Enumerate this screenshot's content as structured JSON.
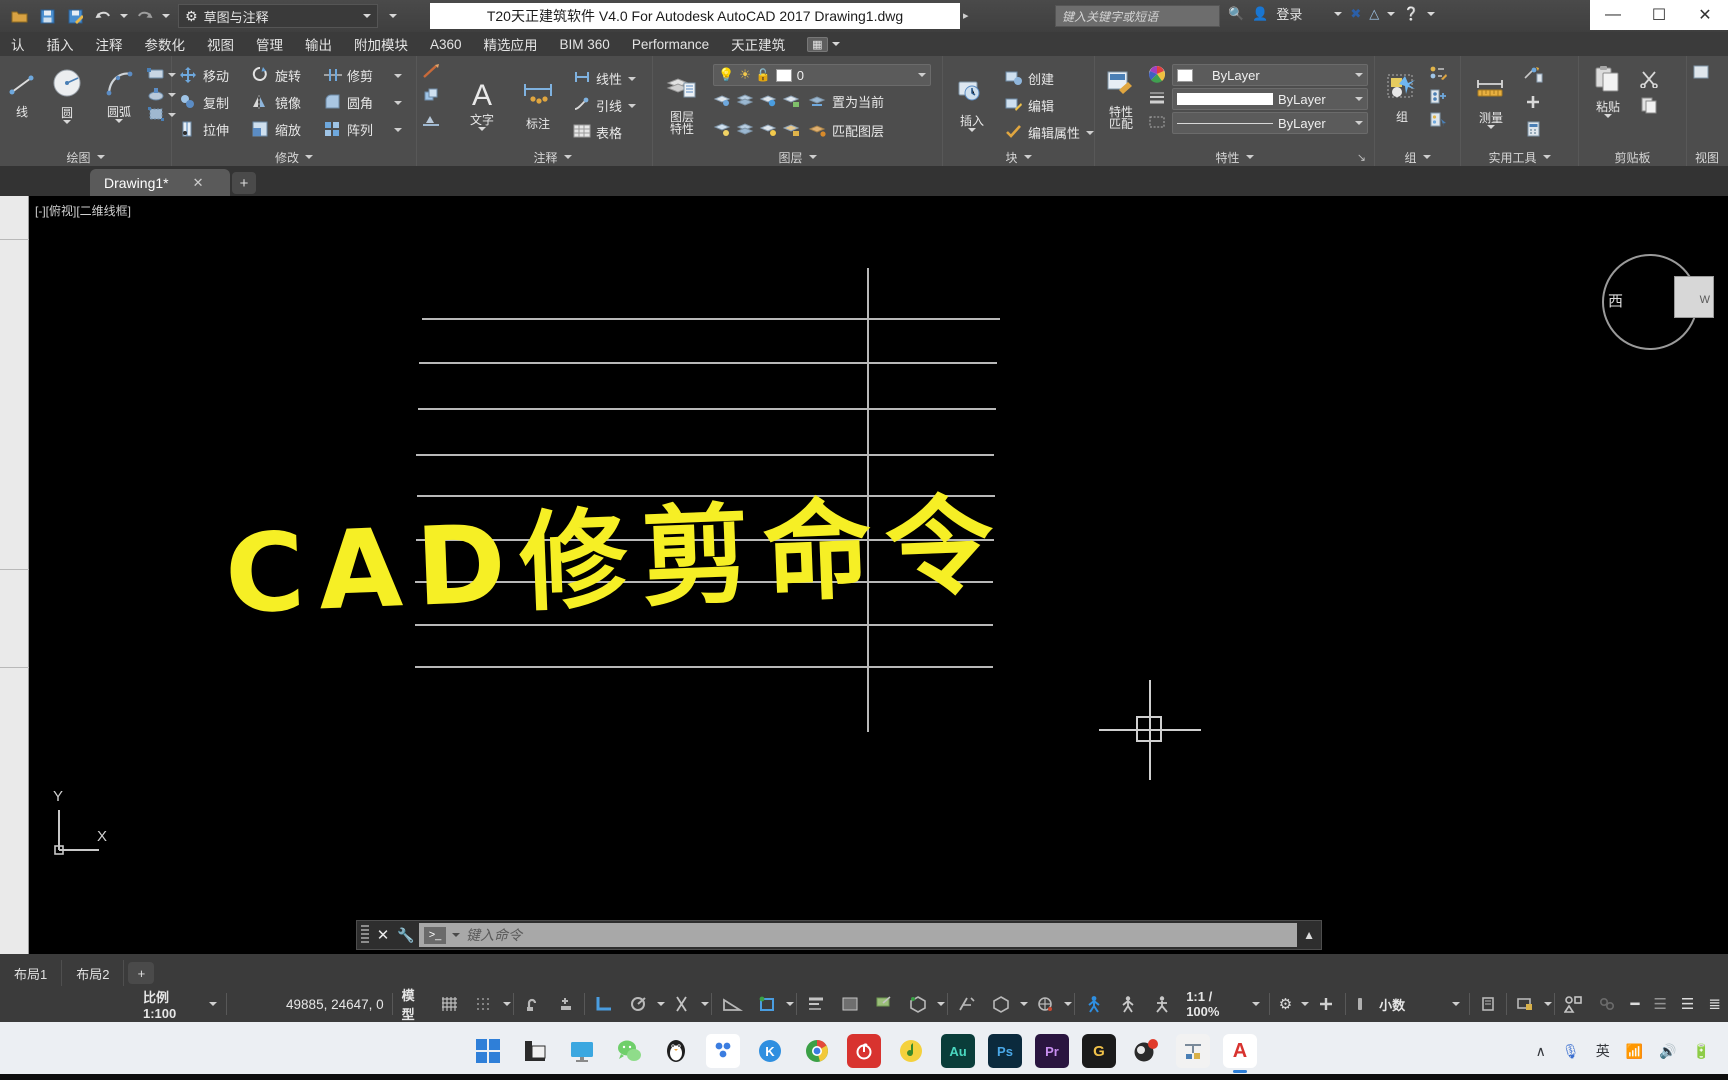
{
  "titlebar": {
    "workspace": "草图与注释",
    "workspace_icon": "gear-icon",
    "document_title": "T20天正建筑软件 V4.0 For Autodesk AutoCAD 2017    Drawing1.dwg",
    "search_placeholder": "键入关键字或短语",
    "signin_label": "登录",
    "quick_access": [
      {
        "name": "open-icon",
        "glyph": "📂"
      },
      {
        "name": "save-icon",
        "glyph": "💾"
      },
      {
        "name": "save-as-icon",
        "glyph": "🖫"
      },
      {
        "name": "undo-icon",
        "glyph": "↩"
      },
      {
        "name": "redo-icon",
        "glyph": "↪"
      }
    ],
    "window_controls": [
      "—",
      "❑",
      "✕"
    ]
  },
  "ribbon_tabs": [
    {
      "label": "认",
      "active": false
    },
    {
      "label": "插入",
      "active": false
    },
    {
      "label": "注释",
      "active": false
    },
    {
      "label": "参数化",
      "active": false
    },
    {
      "label": "视图",
      "active": false
    },
    {
      "label": "管理",
      "active": false
    },
    {
      "label": "输出",
      "active": false
    },
    {
      "label": "附加模块",
      "active": false
    },
    {
      "label": "A360",
      "active": false
    },
    {
      "label": "精选应用",
      "active": false
    },
    {
      "label": "BIM 360",
      "active": false
    },
    {
      "label": "Performance",
      "active": false
    },
    {
      "label": "天正建筑",
      "active": false
    }
  ],
  "panels": {
    "draw": {
      "title": "绘图",
      "items": [
        {
          "label": "线",
          "name": "line-tool"
        },
        {
          "label": "圆",
          "name": "circle-tool"
        },
        {
          "label": "圆弧",
          "name": "arc-tool"
        }
      ],
      "stack": [
        {
          "name": "rectangle-tool"
        },
        {
          "name": "hatch-tool"
        },
        {
          "name": "region-tool"
        }
      ]
    },
    "modify": {
      "title": "修改",
      "items": [
        {
          "label": "移动",
          "name": "move-tool"
        },
        {
          "label": "旋转",
          "name": "rotate-tool"
        },
        {
          "label": "修剪",
          "name": "trim-tool"
        },
        {
          "label": "复制",
          "name": "copy-tool"
        },
        {
          "label": "镜像",
          "name": "mirror-tool"
        },
        {
          "label": "圆角",
          "name": "fillet-tool"
        },
        {
          "label": "拉伸",
          "name": "stretch-tool"
        },
        {
          "label": "缩放",
          "name": "scale-tool"
        },
        {
          "label": "阵列",
          "name": "array-tool"
        }
      ]
    },
    "annotation": {
      "title": "注释",
      "big": [
        {
          "label": "文字",
          "name": "text-tool"
        },
        {
          "label": "标注",
          "name": "dimension-tool"
        }
      ],
      "items": [
        {
          "label": "线性",
          "name": "linear-dim-tool"
        },
        {
          "label": "引线",
          "name": "leader-tool"
        },
        {
          "label": "表格",
          "name": "table-tool"
        }
      ]
    },
    "layers": {
      "title": "图层",
      "big_label": "图层\n特性",
      "current_layer": "0",
      "items": [
        {
          "label": "置为当前",
          "name": "set-current-layer"
        },
        {
          "label": "匹配图层",
          "name": "match-layer"
        }
      ]
    },
    "block": {
      "title": "块",
      "big_label": "插入",
      "items": [
        {
          "label": "创建",
          "name": "create-block"
        },
        {
          "label": "编辑",
          "name": "edit-block"
        },
        {
          "label": "编辑属性",
          "name": "edit-attributes"
        }
      ]
    },
    "properties": {
      "title": "特性",
      "big_label": "特性\n匹配",
      "color": "ByLayer",
      "lineweight": "ByLayer",
      "linetype": "ByLayer"
    },
    "group": {
      "title": "组",
      "big_label": "组"
    },
    "utilities": {
      "title": "实用工具",
      "big_label": "测量"
    },
    "clipboard": {
      "title": "剪贴板",
      "big_label": "粘贴"
    },
    "view": {
      "title": "视图"
    }
  },
  "file_tabs": {
    "tabs": [
      {
        "label": "Drawing1*",
        "active": true
      }
    ],
    "close_glyph": "✕",
    "add_glyph": "+"
  },
  "canvas": {
    "viewport_label": "[-][俯视][二维线框]",
    "headline": "CAD修剪命令",
    "headline_color": "#f6ef25",
    "geometry_color": "#b8b8b8",
    "background": "#000000",
    "ucs": {
      "y_label": "Y",
      "x_label": "X"
    },
    "viewcube": {
      "face_label": "西",
      "edge_label": "W"
    }
  },
  "command_line": {
    "placeholder": "键入命令",
    "close_glyph": "✕",
    "settings_glyph": "🔧",
    "prompt_glyph": "❯_"
  },
  "layout_tabs": [
    {
      "label": "布局1",
      "active": false
    },
    {
      "label": "布局2",
      "active": false
    }
  ],
  "status_bar": {
    "scale_label": "比例 1:100",
    "coordinates": "49885, 24647, 0",
    "model_label": "模型",
    "annotation_scale": "1:1 / 100%",
    "units_label": "小数",
    "toggles": [
      {
        "name": "grid-display-toggle",
        "glyph": "▒"
      },
      {
        "name": "snap-mode-toggle",
        "glyph": "░"
      },
      {
        "name": "infer-constraints-toggle",
        "glyph": "⚲"
      },
      {
        "name": "dynamic-input-toggle",
        "glyph": "⬚"
      },
      {
        "name": "ortho-mode-toggle",
        "glyph": "∟",
        "color": "blue"
      },
      {
        "name": "polar-tracking-toggle",
        "glyph": "↺"
      },
      {
        "name": "object-snap-toggle",
        "glyph": "✕"
      },
      {
        "name": "object-snap-tracking-toggle",
        "glyph": "∠"
      },
      {
        "name": "selection-cycling-toggle",
        "glyph": "□",
        "color": "blue"
      },
      {
        "name": "lineweight-toggle",
        "glyph": "≡"
      },
      {
        "name": "transparency-toggle",
        "glyph": "▓"
      },
      {
        "name": "selection-filter-toggle",
        "glyph": "◧",
        "color": "green"
      },
      {
        "name": "gizmo-toggle",
        "glyph": "⬡",
        "color": "green"
      },
      {
        "name": "annotation-visibility-toggle",
        "glyph": "↗"
      },
      {
        "name": "isolate-objects-toggle",
        "glyph": "⬛"
      },
      {
        "name": "workspace-switch-toggle",
        "glyph": "⚙"
      },
      {
        "name": "customization-toggle",
        "glyph": "☰"
      }
    ]
  },
  "taskbar": {
    "apps": [
      {
        "name": "windows-start-icon",
        "label": "⊞",
        "bg": "#1a7fd4"
      },
      {
        "name": "file-explorer-icon",
        "label": "◰",
        "bg": "#e8e8e8"
      },
      {
        "name": "monitor-icon",
        "label": "■",
        "bg": "#3ba7e0"
      },
      {
        "name": "wechat-icon",
        "label": "❦",
        "bg": "#4ec26a"
      },
      {
        "name": "qq-penguin-icon",
        "label": "●",
        "bg": "#1f1f1f"
      },
      {
        "name": "alipay-icon",
        "label": "✿",
        "bg": "#ffffff"
      },
      {
        "name": "kingsoft-icon",
        "label": "K",
        "bg": "#2f8fe0"
      },
      {
        "name": "chrome-icon",
        "label": "◉",
        "bg": "#ffffff"
      },
      {
        "name": "netease-music-icon",
        "label": "♪",
        "bg": "#d8332f"
      },
      {
        "name": "qq-music-icon",
        "label": "♫",
        "bg": "#f4d13d"
      },
      {
        "name": "audition-icon",
        "label": "Au",
        "bg": "#0a3d3a"
      },
      {
        "name": "photoshop-icon",
        "label": "Ps",
        "bg": "#0b2a3d"
      },
      {
        "name": "premiere-icon",
        "label": "Pr",
        "bg": "#2a1540"
      },
      {
        "name": "gitmind-icon",
        "label": "G",
        "bg": "#1b1b1b"
      },
      {
        "name": "obs-icon",
        "label": "●",
        "bg": "#2b2b2b"
      },
      {
        "name": "tianzheng-icon",
        "label": "⚒",
        "bg": "#f2f2f2"
      },
      {
        "name": "autocad-icon",
        "label": "A",
        "bg": "#ffffff",
        "active": true
      }
    ],
    "tray": [
      {
        "name": "show-hidden-icons",
        "glyph": "∧"
      },
      {
        "name": "microphone-icon",
        "glyph": "🎤"
      },
      {
        "name": "ime-language-indicator",
        "glyph": "英"
      },
      {
        "name": "wifi-icon",
        "glyph": ""
      },
      {
        "name": "volume-icon",
        "glyph": "🔊"
      },
      {
        "name": "battery-icon",
        "glyph": "▬"
      }
    ]
  }
}
